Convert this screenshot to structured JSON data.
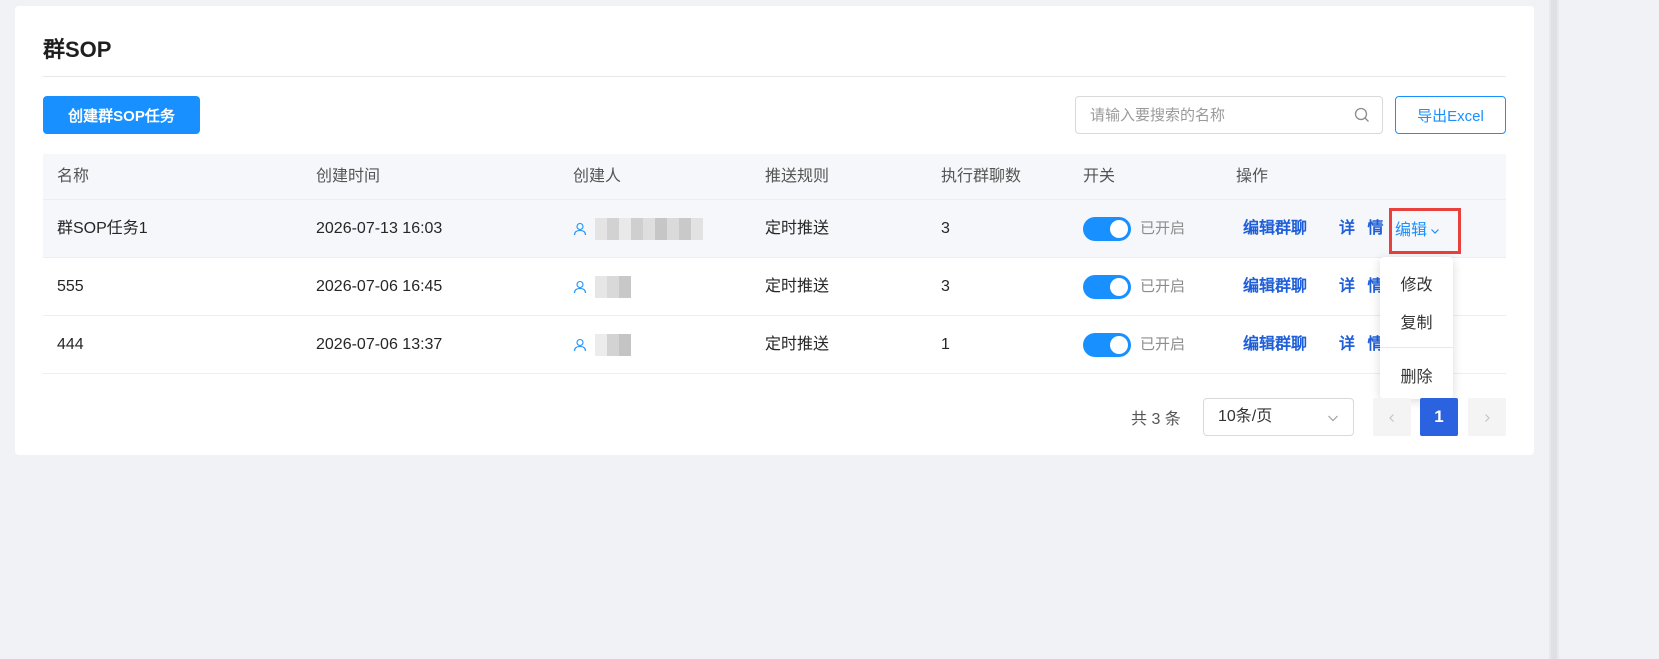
{
  "page": {
    "title": "群SOP"
  },
  "toolbar": {
    "create_label": "创建群SOP任务",
    "search_placeholder": "请输入要搜索的名称",
    "export_label": "导出Excel"
  },
  "table": {
    "headers": [
      "名称",
      "创建时间",
      "创建人",
      "推送规则",
      "执行群聊数",
      "开关",
      "操作"
    ],
    "rows": [
      {
        "name": "群SOP任务1",
        "created_at": "2026-07-13 16:03",
        "creator": "",
        "rule": "定时推送",
        "group_count": "3",
        "switch_on": true,
        "switch_label": "已开启"
      },
      {
        "name": "555",
        "created_at": "2026-07-06 16:45",
        "creator": "",
        "rule": "定时推送",
        "group_count": "3",
        "switch_on": true,
        "switch_label": "已开启"
      },
      {
        "name": "444",
        "created_at": "2026-07-06 13:37",
        "creator": "",
        "rule": "定时推送",
        "group_count": "1",
        "switch_on": true,
        "switch_label": "已开启"
      }
    ],
    "actions": {
      "edit_groups": "编辑群聊",
      "detail": "详 情",
      "more": "编辑"
    }
  },
  "dropdown": {
    "items": [
      "修改",
      "复制",
      "删除"
    ]
  },
  "pagination": {
    "total_text": "共 3 条",
    "page_size": "10条/页",
    "current_page": "1"
  },
  "colors": {
    "primary": "#1890ff",
    "link": "#1e5ed8",
    "highlight_border": "#e8403b"
  },
  "icons": [
    "search-icon",
    "user-icon",
    "chevron-down-icon",
    "chevron-left-icon",
    "chevron-right-icon"
  ]
}
